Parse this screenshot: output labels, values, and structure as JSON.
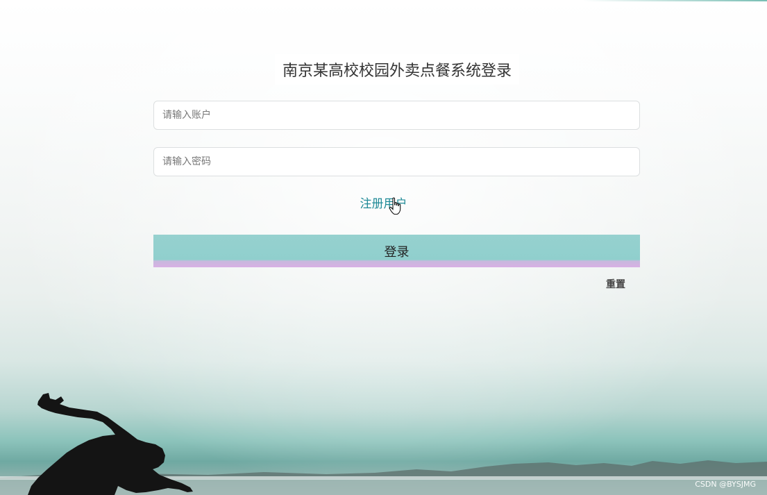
{
  "page": {
    "title": "南京某高校校园外卖点餐系统登录"
  },
  "form": {
    "account_placeholder": "请输入账户",
    "password_placeholder": "请输入密码",
    "register_label": "注册用户",
    "login_label": "登录",
    "reset_label": "重置"
  },
  "watermark": "CSDN @BYSJMG",
  "colors": {
    "login_button": "#96d1cf",
    "login_button_border": "#d8b0e4",
    "register_link": "#1f8a97",
    "title_text": "#333333"
  },
  "icons": {
    "cursor": "hand-pointer-icon"
  }
}
